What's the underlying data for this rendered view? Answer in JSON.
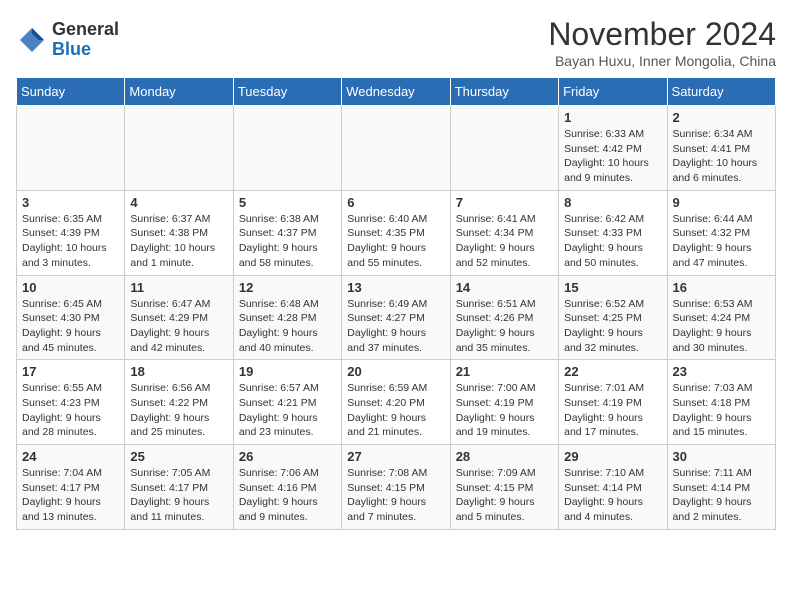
{
  "logo": {
    "general": "General",
    "blue": "Blue"
  },
  "title": "November 2024",
  "subtitle": "Bayan Huxu, Inner Mongolia, China",
  "days_of_week": [
    "Sunday",
    "Monday",
    "Tuesday",
    "Wednesday",
    "Thursday",
    "Friday",
    "Saturday"
  ],
  "weeks": [
    [
      {
        "day": "",
        "info": ""
      },
      {
        "day": "",
        "info": ""
      },
      {
        "day": "",
        "info": ""
      },
      {
        "day": "",
        "info": ""
      },
      {
        "day": "",
        "info": ""
      },
      {
        "day": "1",
        "info": "Sunrise: 6:33 AM\nSunset: 4:42 PM\nDaylight: 10 hours and 9 minutes."
      },
      {
        "day": "2",
        "info": "Sunrise: 6:34 AM\nSunset: 4:41 PM\nDaylight: 10 hours and 6 minutes."
      }
    ],
    [
      {
        "day": "3",
        "info": "Sunrise: 6:35 AM\nSunset: 4:39 PM\nDaylight: 10 hours and 3 minutes."
      },
      {
        "day": "4",
        "info": "Sunrise: 6:37 AM\nSunset: 4:38 PM\nDaylight: 10 hours and 1 minute."
      },
      {
        "day": "5",
        "info": "Sunrise: 6:38 AM\nSunset: 4:37 PM\nDaylight: 9 hours and 58 minutes."
      },
      {
        "day": "6",
        "info": "Sunrise: 6:40 AM\nSunset: 4:35 PM\nDaylight: 9 hours and 55 minutes."
      },
      {
        "day": "7",
        "info": "Sunrise: 6:41 AM\nSunset: 4:34 PM\nDaylight: 9 hours and 52 minutes."
      },
      {
        "day": "8",
        "info": "Sunrise: 6:42 AM\nSunset: 4:33 PM\nDaylight: 9 hours and 50 minutes."
      },
      {
        "day": "9",
        "info": "Sunrise: 6:44 AM\nSunset: 4:32 PM\nDaylight: 9 hours and 47 minutes."
      }
    ],
    [
      {
        "day": "10",
        "info": "Sunrise: 6:45 AM\nSunset: 4:30 PM\nDaylight: 9 hours and 45 minutes."
      },
      {
        "day": "11",
        "info": "Sunrise: 6:47 AM\nSunset: 4:29 PM\nDaylight: 9 hours and 42 minutes."
      },
      {
        "day": "12",
        "info": "Sunrise: 6:48 AM\nSunset: 4:28 PM\nDaylight: 9 hours and 40 minutes."
      },
      {
        "day": "13",
        "info": "Sunrise: 6:49 AM\nSunset: 4:27 PM\nDaylight: 9 hours and 37 minutes."
      },
      {
        "day": "14",
        "info": "Sunrise: 6:51 AM\nSunset: 4:26 PM\nDaylight: 9 hours and 35 minutes."
      },
      {
        "day": "15",
        "info": "Sunrise: 6:52 AM\nSunset: 4:25 PM\nDaylight: 9 hours and 32 minutes."
      },
      {
        "day": "16",
        "info": "Sunrise: 6:53 AM\nSunset: 4:24 PM\nDaylight: 9 hours and 30 minutes."
      }
    ],
    [
      {
        "day": "17",
        "info": "Sunrise: 6:55 AM\nSunset: 4:23 PM\nDaylight: 9 hours and 28 minutes."
      },
      {
        "day": "18",
        "info": "Sunrise: 6:56 AM\nSunset: 4:22 PM\nDaylight: 9 hours and 25 minutes."
      },
      {
        "day": "19",
        "info": "Sunrise: 6:57 AM\nSunset: 4:21 PM\nDaylight: 9 hours and 23 minutes."
      },
      {
        "day": "20",
        "info": "Sunrise: 6:59 AM\nSunset: 4:20 PM\nDaylight: 9 hours and 21 minutes."
      },
      {
        "day": "21",
        "info": "Sunrise: 7:00 AM\nSunset: 4:19 PM\nDaylight: 9 hours and 19 minutes."
      },
      {
        "day": "22",
        "info": "Sunrise: 7:01 AM\nSunset: 4:19 PM\nDaylight: 9 hours and 17 minutes."
      },
      {
        "day": "23",
        "info": "Sunrise: 7:03 AM\nSunset: 4:18 PM\nDaylight: 9 hours and 15 minutes."
      }
    ],
    [
      {
        "day": "24",
        "info": "Sunrise: 7:04 AM\nSunset: 4:17 PM\nDaylight: 9 hours and 13 minutes."
      },
      {
        "day": "25",
        "info": "Sunrise: 7:05 AM\nSunset: 4:17 PM\nDaylight: 9 hours and 11 minutes."
      },
      {
        "day": "26",
        "info": "Sunrise: 7:06 AM\nSunset: 4:16 PM\nDaylight: 9 hours and 9 minutes."
      },
      {
        "day": "27",
        "info": "Sunrise: 7:08 AM\nSunset: 4:15 PM\nDaylight: 9 hours and 7 minutes."
      },
      {
        "day": "28",
        "info": "Sunrise: 7:09 AM\nSunset: 4:15 PM\nDaylight: 9 hours and 5 minutes."
      },
      {
        "day": "29",
        "info": "Sunrise: 7:10 AM\nSunset: 4:14 PM\nDaylight: 9 hours and 4 minutes."
      },
      {
        "day": "30",
        "info": "Sunrise: 7:11 AM\nSunset: 4:14 PM\nDaylight: 9 hours and 2 minutes."
      }
    ]
  ]
}
